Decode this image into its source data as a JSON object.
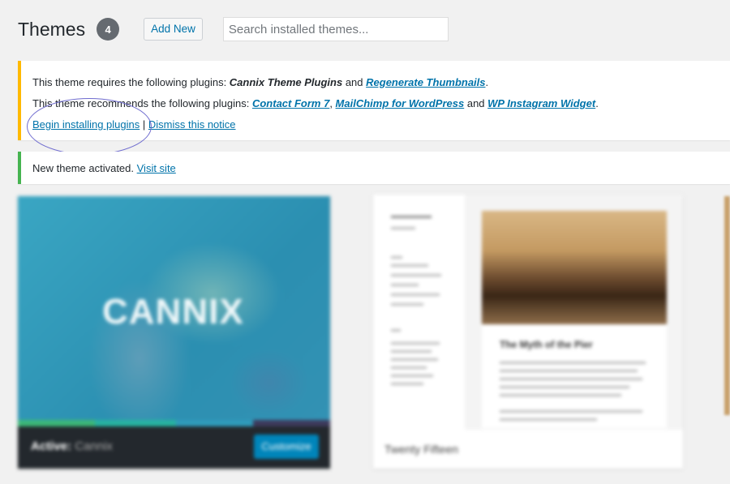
{
  "header": {
    "title": "Themes",
    "count": "4",
    "add_new_label": "Add New",
    "search_placeholder": "Search installed themes..."
  },
  "plugin_notice": {
    "line1_prefix": "This theme requires the following plugins: ",
    "required_plugin_1": "Cannix Theme Plugins",
    "line1_and": " and ",
    "required_plugin_2": "Regenerate Thumbnails",
    "line1_end": ".",
    "line2_prefix": "This theme recommends the following plugins: ",
    "recommended_plugin_1": "Contact Form 7",
    "line2_comma": ", ",
    "recommended_plugin_2": "MailChimp for WordPress",
    "line2_and": " and ",
    "recommended_plugin_3": "WP Instagram Widget",
    "line2_end": ".",
    "begin_installing_label": "Begin installing plugins",
    "separator": " | ",
    "dismiss_label": "Dismiss this notice",
    "border_color": "#ffb900"
  },
  "activated_notice": {
    "message": "New theme activated. ",
    "visit_site_label": "Visit site",
    "border_color": "#46b450"
  },
  "themes": [
    {
      "logo_text": "CANNIX",
      "status_label": "Active:",
      "name": "Cannix",
      "customize_label": "Customize",
      "colors": [
        "#2f9bbb",
        "#23282d",
        "#0085ba"
      ]
    },
    {
      "name": "Twenty Fifteen",
      "post_title": "The Myth of the Pier"
    }
  ],
  "colors": {
    "link": "#0073aa",
    "background": "#f1f1f1"
  }
}
